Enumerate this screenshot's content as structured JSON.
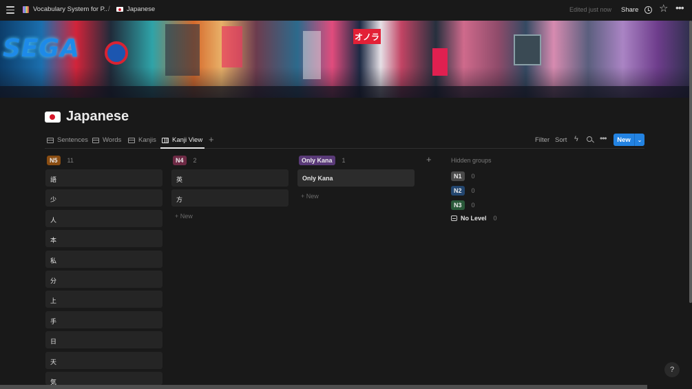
{
  "topbar": {
    "breadcrumb_parent": "Vocabulary System for P...",
    "breadcrumb_sep": "/",
    "breadcrumb_current": "Japanese",
    "edited": "Edited just now",
    "share": "Share"
  },
  "banner": {
    "sign_left": "SEGA",
    "sign_center": "オノラ"
  },
  "page": {
    "title": "Japanese"
  },
  "views": {
    "tabs": [
      {
        "label": "Sentences",
        "icon": "table-icon"
      },
      {
        "label": "Words",
        "icon": "table-icon"
      },
      {
        "label": "Kanjis",
        "icon": "table-icon"
      },
      {
        "label": "Kanji View",
        "icon": "board-icon"
      }
    ],
    "add": "+",
    "filter": "Filter",
    "sort": "Sort",
    "new": "New"
  },
  "board": {
    "groups": [
      {
        "tag": "N5",
        "color": "#8a4d12",
        "count": "11",
        "cards": [
          "語",
          "少",
          "人",
          "本",
          "私",
          "分",
          "上",
          "手",
          "日",
          "天",
          "気"
        ]
      },
      {
        "tag": "N4",
        "color": "#6e2a45",
        "count": "2",
        "cards": [
          "英",
          "方"
        ],
        "new_label": "New"
      },
      {
        "tag": "Only Kana",
        "color": "#5a3a78",
        "count": "1",
        "cards": [
          "Only Kana"
        ],
        "new_label": "New"
      }
    ],
    "add_group": "+",
    "hidden": {
      "title": "Hidden groups",
      "items": [
        {
          "tag": "N1",
          "color": "#4a4a4a",
          "count": "0"
        },
        {
          "tag": "N2",
          "color": "#23466f",
          "count": "0"
        },
        {
          "tag": "N3",
          "color": "#2a5a3a",
          "count": "0"
        },
        {
          "tag": "No Level",
          "count": "0"
        }
      ]
    }
  },
  "help": "?"
}
